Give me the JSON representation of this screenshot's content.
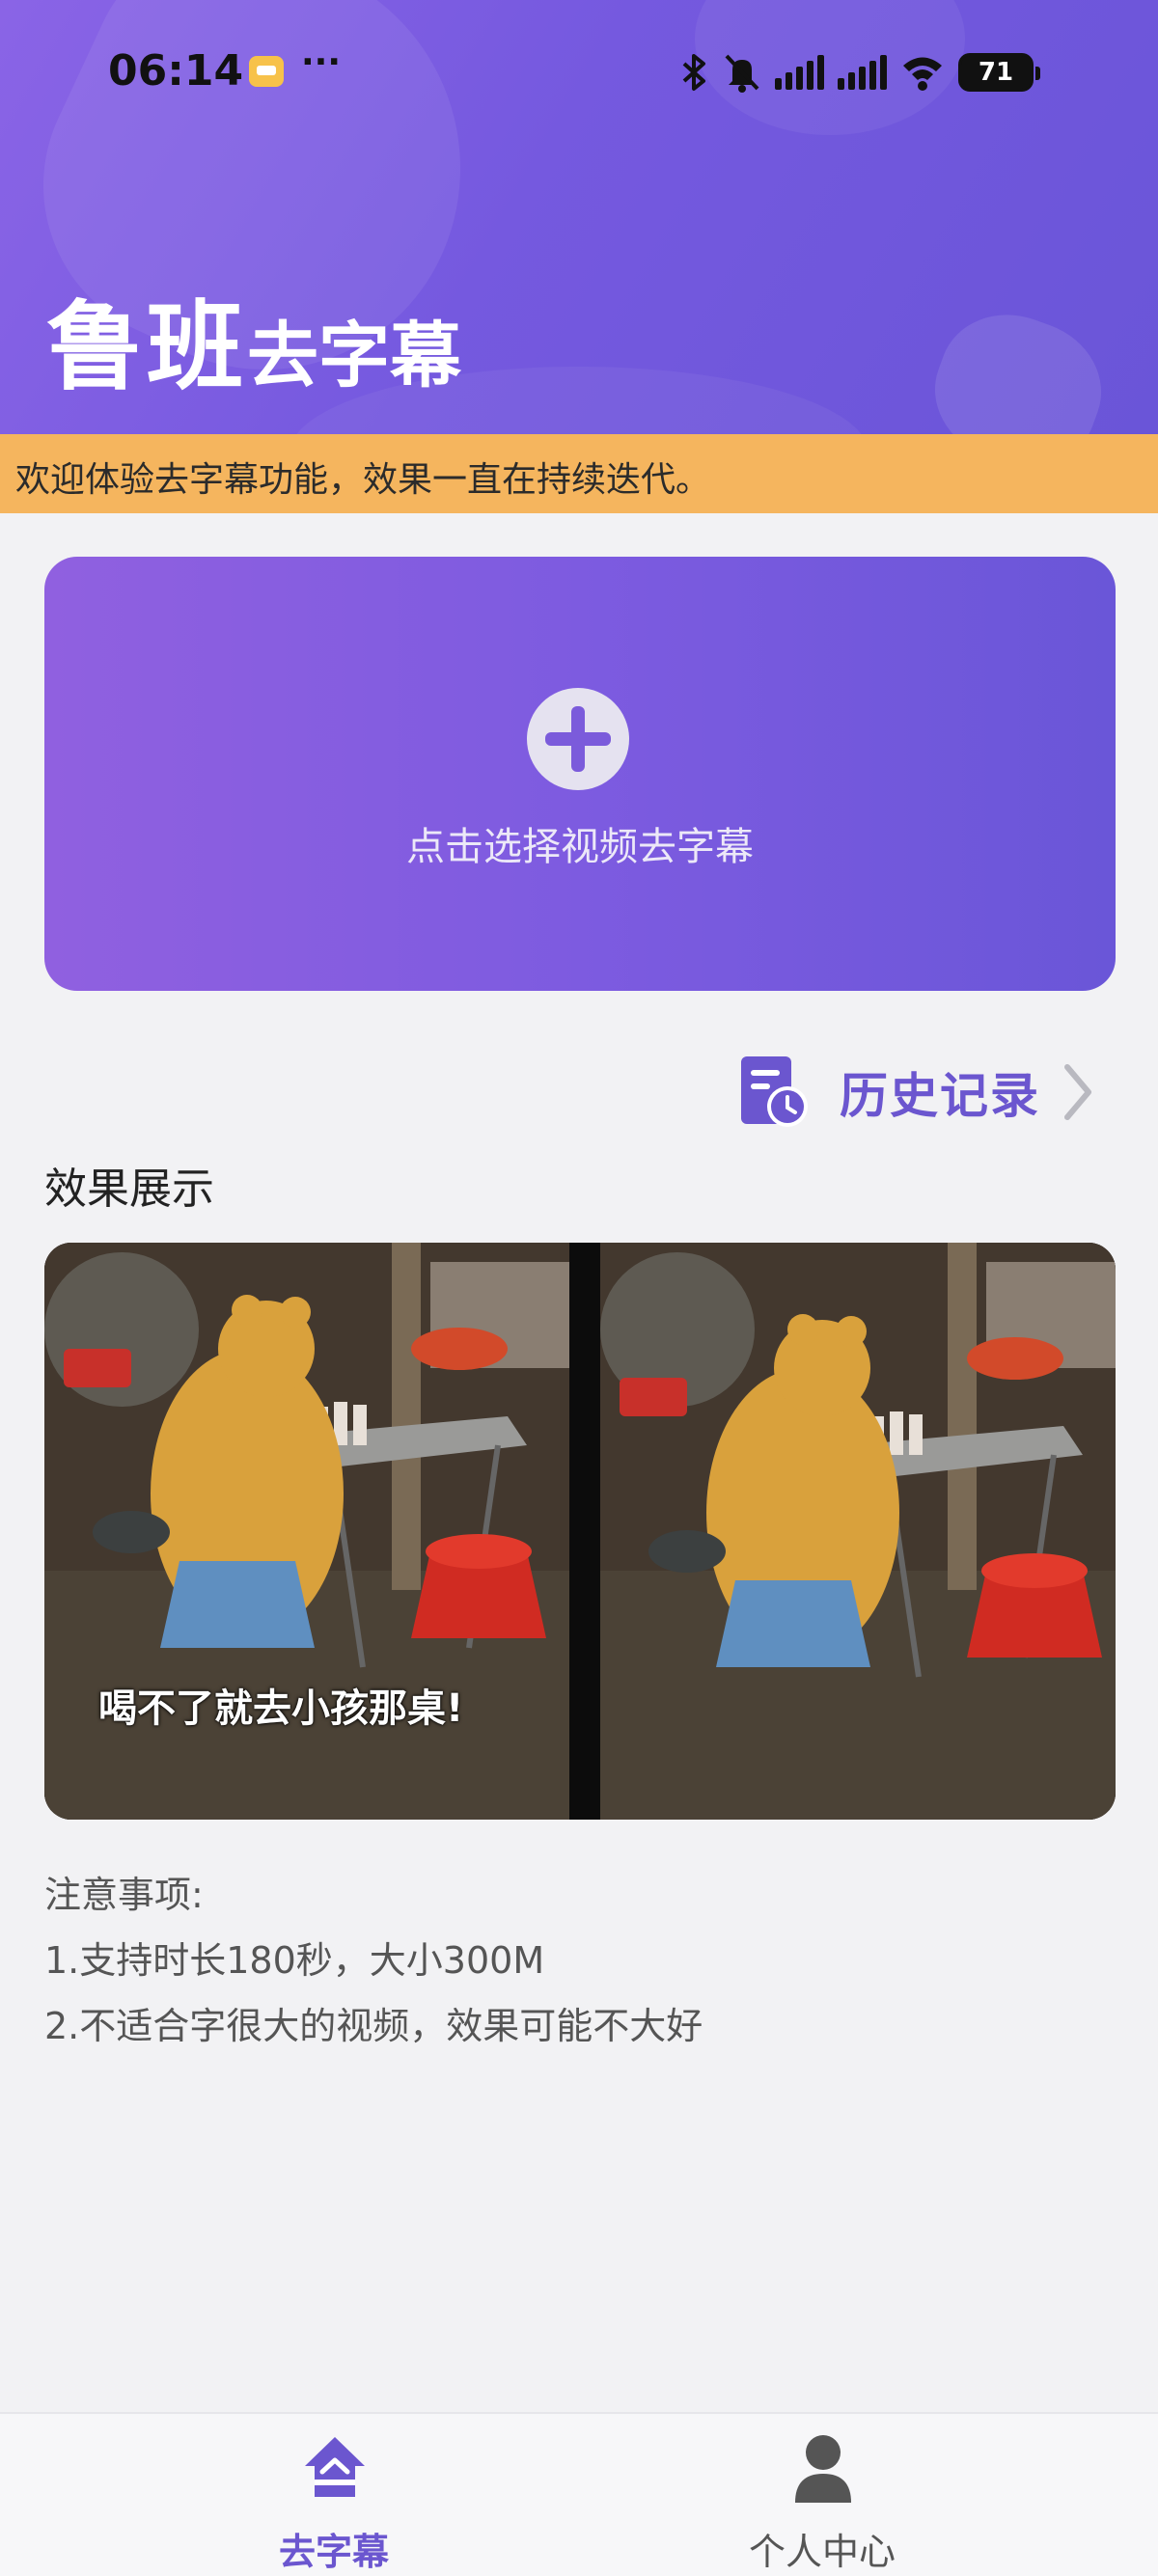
{
  "status_bar": {
    "time": "06:14",
    "more": "···",
    "battery": "71",
    "icons": [
      "notification-app-icon",
      "bluetooth-icon",
      "mute-icon",
      "signal-icon",
      "signal-icon",
      "wifi-icon",
      "battery-icon"
    ]
  },
  "header": {
    "title_big": "鲁班",
    "title_small": "去字幕"
  },
  "notice": {
    "text": "欢迎体验去字幕功能，效果一直在持续迭代。"
  },
  "upload": {
    "label": "点击选择视频去字幕",
    "icon": "plus-circle-icon"
  },
  "history": {
    "label": "历史记录",
    "icon": "history-icon"
  },
  "demo": {
    "section_title": "效果展示",
    "subtitle_text": "喝不了就去小孩那桌!"
  },
  "notes": {
    "title": "注意事项:",
    "items": [
      "1.支持时长180秒，大小300M",
      "2.不适合字很大的视频，效果可能不大好"
    ]
  },
  "bottom_nav": {
    "items": [
      {
        "label": "去字幕",
        "icon": "home-icon",
        "active": true
      },
      {
        "label": "个人中心",
        "icon": "user-icon",
        "active": false
      }
    ]
  },
  "colors": {
    "accent": "#6b56cf",
    "header_gradient_start": "#8a64e6",
    "header_gradient_end": "#6a55d8",
    "notice_bg": "#f5b55e"
  }
}
